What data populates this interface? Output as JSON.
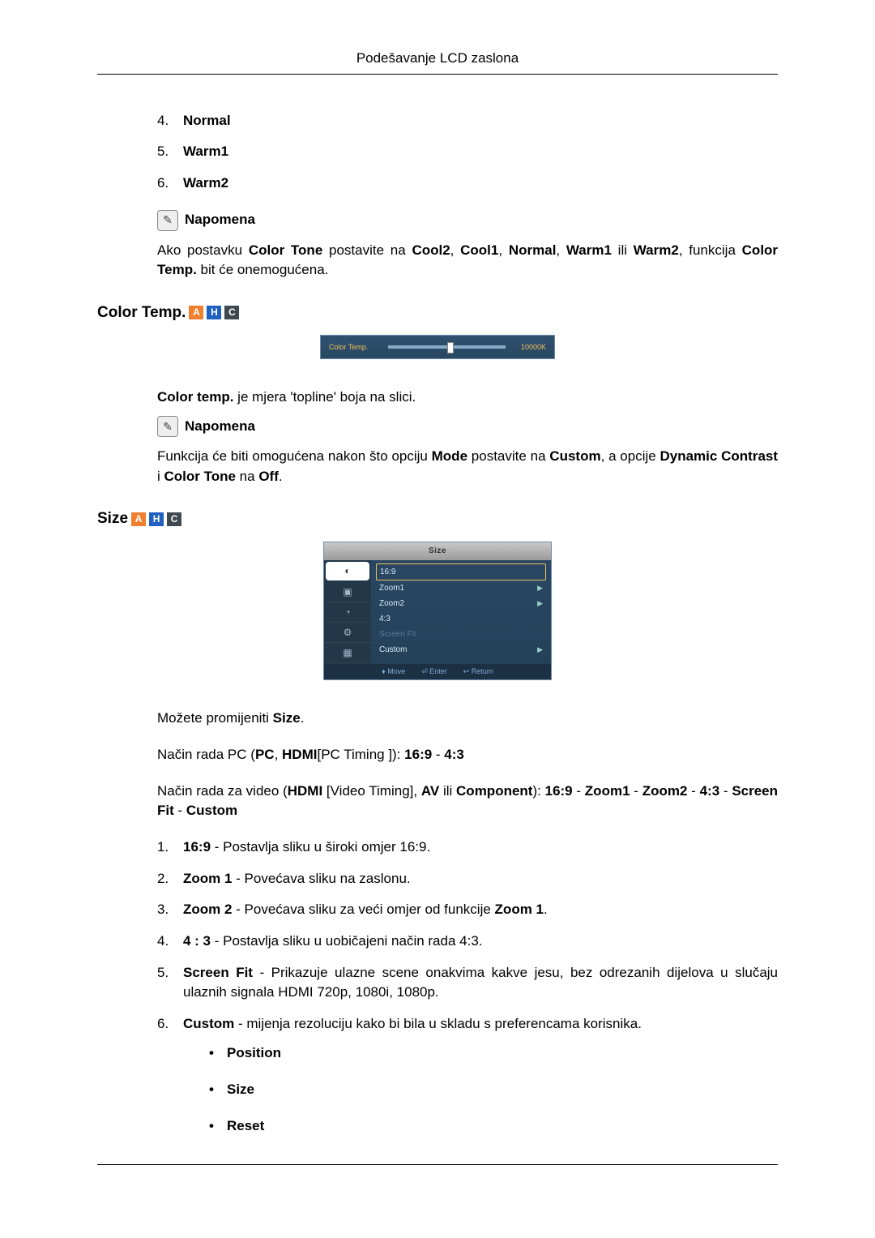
{
  "header": {
    "title": "Podešavanje LCD zaslona"
  },
  "list_top": {
    "items": [
      {
        "num": "4.",
        "label": "Normal"
      },
      {
        "num": "5.",
        "label": "Warm1"
      },
      {
        "num": "6.",
        "label": "Warm2"
      }
    ]
  },
  "note1": {
    "label": "Napomena",
    "text_pre": "Ako postavku ",
    "b1": "Color Tone",
    "text_mid1": " postavite na ",
    "b2": "Cool2",
    "sep": ", ",
    "b3": "Cool1",
    "b4": "Normal",
    "b5": "Warm1",
    "or": " ili ",
    "b6": "Warm2",
    "text_mid2": ", funkcija ",
    "b7": "Color Temp.",
    "text_post": " bit će onemogućena."
  },
  "section_color_temp": {
    "title": "Color Temp.",
    "tags": [
      "A",
      "H",
      "C"
    ],
    "osd": {
      "label": "Color Temp.",
      "value": "10000K"
    },
    "para_pre": "",
    "b1": "Color temp.",
    "para_post": " je mjera 'topline' boja na slici."
  },
  "note2": {
    "label": "Napomena",
    "pre": "Funkcija će biti omogućena nakon što opciju ",
    "b1": "Mode",
    "mid1": " postavite na ",
    "b2": "Custom",
    "mid2": ", a opcije ",
    "b3": "Dynamic Contrast",
    "and": " i ",
    "b4": "Color Tone",
    "on": " na ",
    "b5": "Off",
    "post": "."
  },
  "section_size": {
    "title": "Size",
    "tags": [
      "A",
      "H",
      "C"
    ],
    "osd": {
      "header": "Size",
      "options": [
        {
          "label": "16:9",
          "selected": true
        },
        {
          "label": "Zoom1",
          "arrow": "▶"
        },
        {
          "label": "Zoom2",
          "arrow": "▶"
        },
        {
          "label": "4:3"
        },
        {
          "label": "Screen Fit",
          "disabled": true
        },
        {
          "label": "Custom",
          "arrow": "▶"
        }
      ],
      "foot": {
        "move": "Move",
        "enter": "Enter",
        "return": "Return"
      }
    },
    "p1_pre": "Možete promijeniti ",
    "p1_b": "Size",
    "p1_post": ".",
    "p2_a": "Način rada PC (",
    "p2_b1": "PC",
    "p2_sep": ", ",
    "p2_b2": "HDMI",
    "p2_c": "[PC Timing ]): ",
    "p2_b3": "16:9",
    "p2_d": " - ",
    "p2_b4": "4:3",
    "p3_a": "Način rada za video (",
    "p3_b1": "HDMI",
    "p3_c": " [Video Timing], ",
    "p3_b2": "AV",
    "p3_or": " ili ",
    "p3_b3": "Component",
    "p3_d": "): ",
    "p3_b4": "16:9",
    "p3_dash": " - ",
    "p3_b5": "Zoom1",
    "p3_b6": "Zoom2",
    "p3_b7": "4:3",
    "p3_e": "- ",
    "p3_b8": "Screen Fit",
    "p3_b9": "Custom",
    "list": [
      {
        "num": "1.",
        "b": "16:9",
        "text": " - Postavlja sliku u široki omjer 16:9."
      },
      {
        "num": "2.",
        "b": "Zoom 1",
        "text": " - Povećava sliku na zaslonu."
      },
      {
        "num": "3.",
        "b": "Zoom 2",
        "text": " - Povećava sliku za veći omjer od funkcije ",
        "b2": "Zoom 1",
        "text2": "."
      },
      {
        "num": "4.",
        "b": "4 : 3",
        "text": " - Postavlja sliku u uobičajeni način rada 4:3."
      },
      {
        "num": "5.",
        "b": "Screen Fit",
        "text": " - Prikazuje ulazne scene onakvima kakve jesu, bez odrezanih dijelova u slučaju ulaznih signala HDMI 720p, 1080i, 1080p."
      },
      {
        "num": "6.",
        "b": "Custom",
        "text": " - mijenja rezoluciju kako bi bila u skladu s preferencama korisnika."
      }
    ],
    "bullets": [
      {
        "label": "Position"
      },
      {
        "label": "Size"
      },
      {
        "label": "Reset"
      }
    ]
  }
}
